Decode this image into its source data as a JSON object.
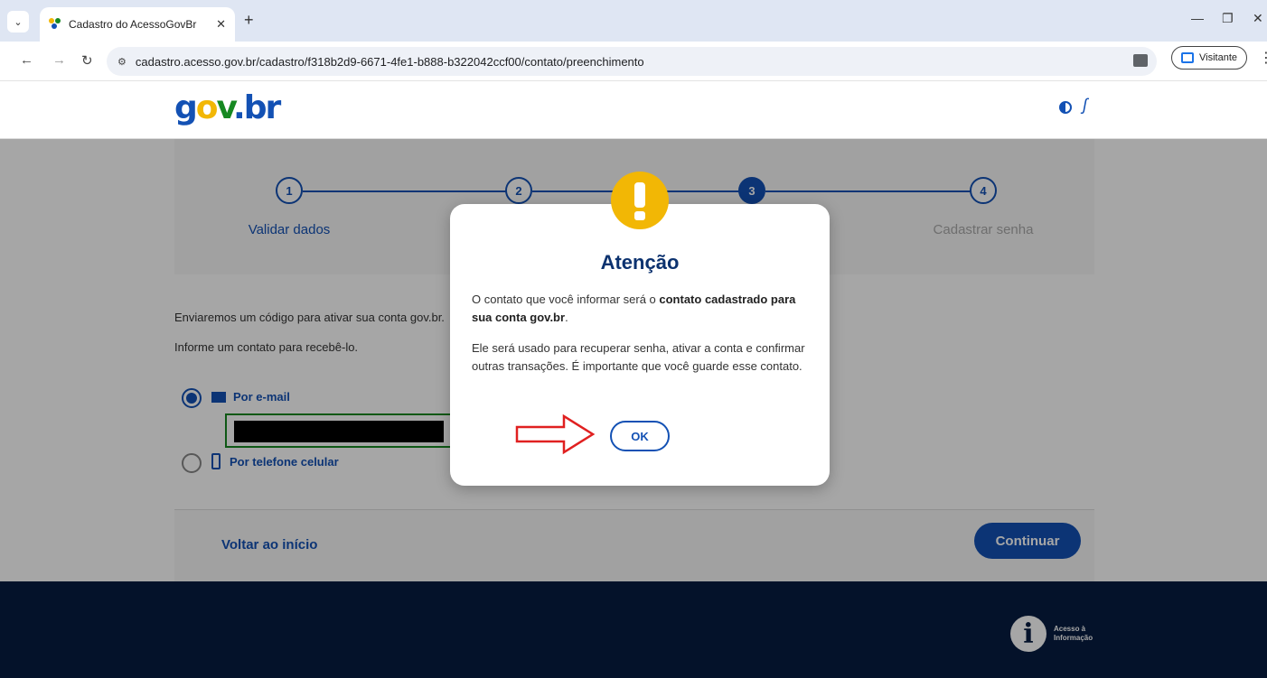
{
  "browser": {
    "tab_title": "Cadastro do AcessoGovBr",
    "tab_close": "✕",
    "new_tab": "+",
    "url": "cadastro.acesso.gov.br/cadastro/f318b2d9-6671-4fe1-b888-b322042ccf00/contato/preenchimento",
    "profile_label": "Visitante",
    "minimize": "—",
    "restore": "❐",
    "close": "✕"
  },
  "header": {
    "logo_g": "g",
    "logo_o": "o",
    "logo_v": "v",
    "logo_dot": ".",
    "logo_br": "br"
  },
  "stepper": {
    "steps": [
      {
        "number": "1",
        "label": "Validar dados"
      },
      {
        "number": "2",
        "label": ""
      },
      {
        "number": "3",
        "label": ""
      },
      {
        "number": "4",
        "label": "Cadastrar senha"
      }
    ],
    "current_step": 3
  },
  "form": {
    "intro_line1": "Enviaremos um código para ativar sua conta gov.br.",
    "intro_line2": "Informe um contato para recebê-lo.",
    "option_email": "Por e-mail",
    "option_phone": "Por telefone celular",
    "back_link": "Voltar ao início",
    "continue": "Continuar"
  },
  "footer": {
    "ai_line1": "Acesso à",
    "ai_line2": "Informação"
  },
  "modal": {
    "title": "Atenção",
    "p1_start": "O contato que você informar será o ",
    "p1_bold": "contato cadastrado para sua conta gov.br",
    "p1_end": ".",
    "p2": "Ele será usado para recuperar senha, ativar a conta e confirmar outras transações. É importante que você guarde esse contato.",
    "ok": "OK"
  },
  "colors": {
    "primary": "#1351b4",
    "warning": "#f2b705",
    "success": "#168821",
    "footer_bg": "#071d41",
    "annotation_arrow": "#e02020"
  }
}
